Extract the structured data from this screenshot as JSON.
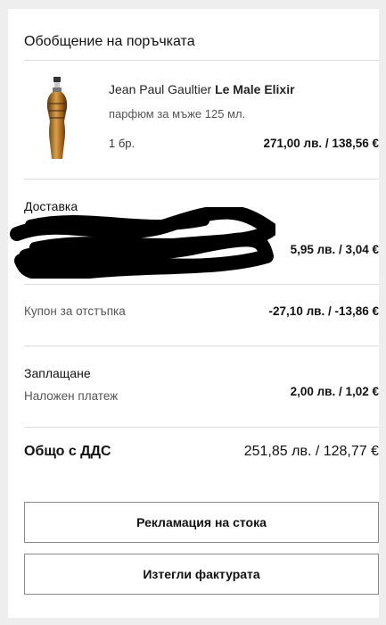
{
  "summary": {
    "title": "Обобщение на поръчката"
  },
  "product": {
    "brand": "Jean Paul Gaultier",
    "name": "Le Male Elixir",
    "description": "парфюм за мъже 125 мл.",
    "quantity": "1 бр.",
    "price": "271,00 лв. / 138,56 €"
  },
  "delivery": {
    "heading": "Доставка",
    "price": "5,95 лв. / 3,04 €"
  },
  "coupon": {
    "label": "Купон за отстъпка",
    "price": "-27,10 лв. / -13,86 €"
  },
  "payment": {
    "heading": "Заплащане",
    "method": "Наложен платеж",
    "price": "2,00 лв. / 1,02 €"
  },
  "total": {
    "label": "Общо с ДДС",
    "value": "251,85 лв. / 128,77 €"
  },
  "buttons": {
    "complaint": "Рекламация на стока",
    "invoice": "Изтегли фактурата"
  },
  "colors": {
    "background": "#eeeeee",
    "card": "#ffffff",
    "divider": "#dcdcdc",
    "button_border": "#8a8a8a",
    "product_gold": "#b07a2a"
  }
}
